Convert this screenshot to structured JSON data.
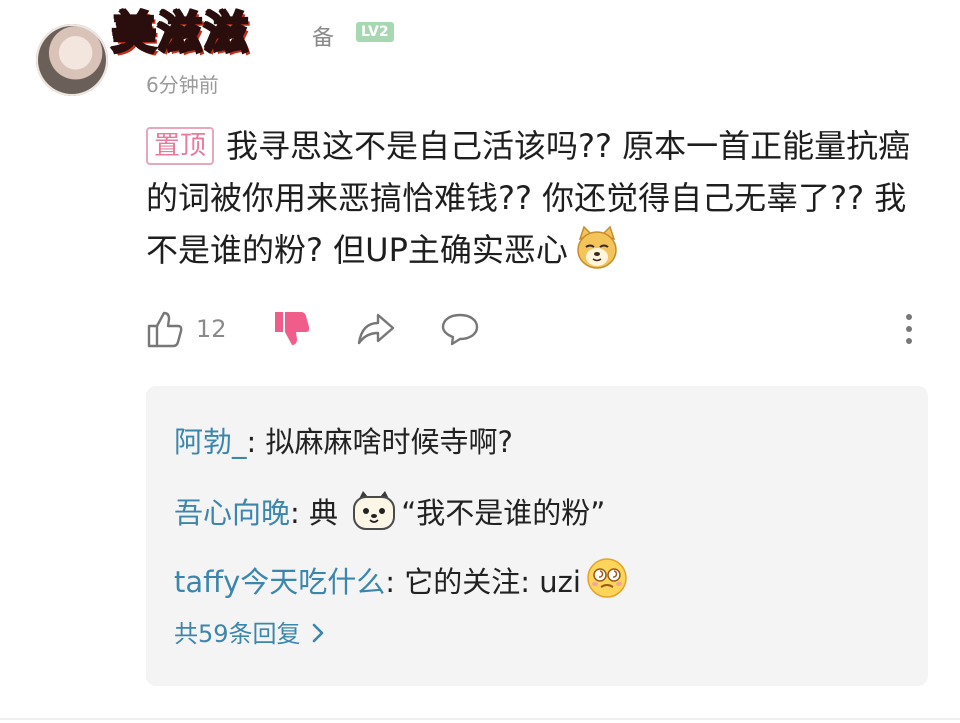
{
  "header": {
    "username": "美滋滋",
    "username_tail": "备",
    "level": "LV2",
    "timestamp": "6分钟前"
  },
  "comment": {
    "pin_label": "置顶",
    "text": "我寻思这不是自己活该吗?? 原本一首正能量抗癌的词被你用来恶搞恰难钱?? 你还觉得自己无辜了?? 我不是谁的粉? 但UP主确实恶心",
    "emoji": "doge-emoji"
  },
  "actions": {
    "like_count": "12",
    "icons": [
      "thumbs-up-icon",
      "dislike-icon",
      "share-icon",
      "reply-bubble-icon",
      "more-vertical-icon"
    ],
    "dislike_color": "#f05d8a"
  },
  "replies": [
    {
      "user": "阿勃_",
      "text": ": 拟麻麻啥时候寺啊?"
    },
    {
      "user": "吾心向晚",
      "text_before": ": 典 ",
      "emoji": "dog-face-emoji",
      "text_after": "“我不是谁的粉”"
    },
    {
      "user": "taffy今天吃什么",
      "text": ": 它的关注: uzi",
      "emoji": "dizzy-face-emoji"
    }
  ],
  "more_replies_label": "共59条回复",
  "colors": {
    "link_blue": "#3b86ad",
    "pin_pink": "#e87b9b",
    "reply_bg": "#f4f4f4"
  }
}
